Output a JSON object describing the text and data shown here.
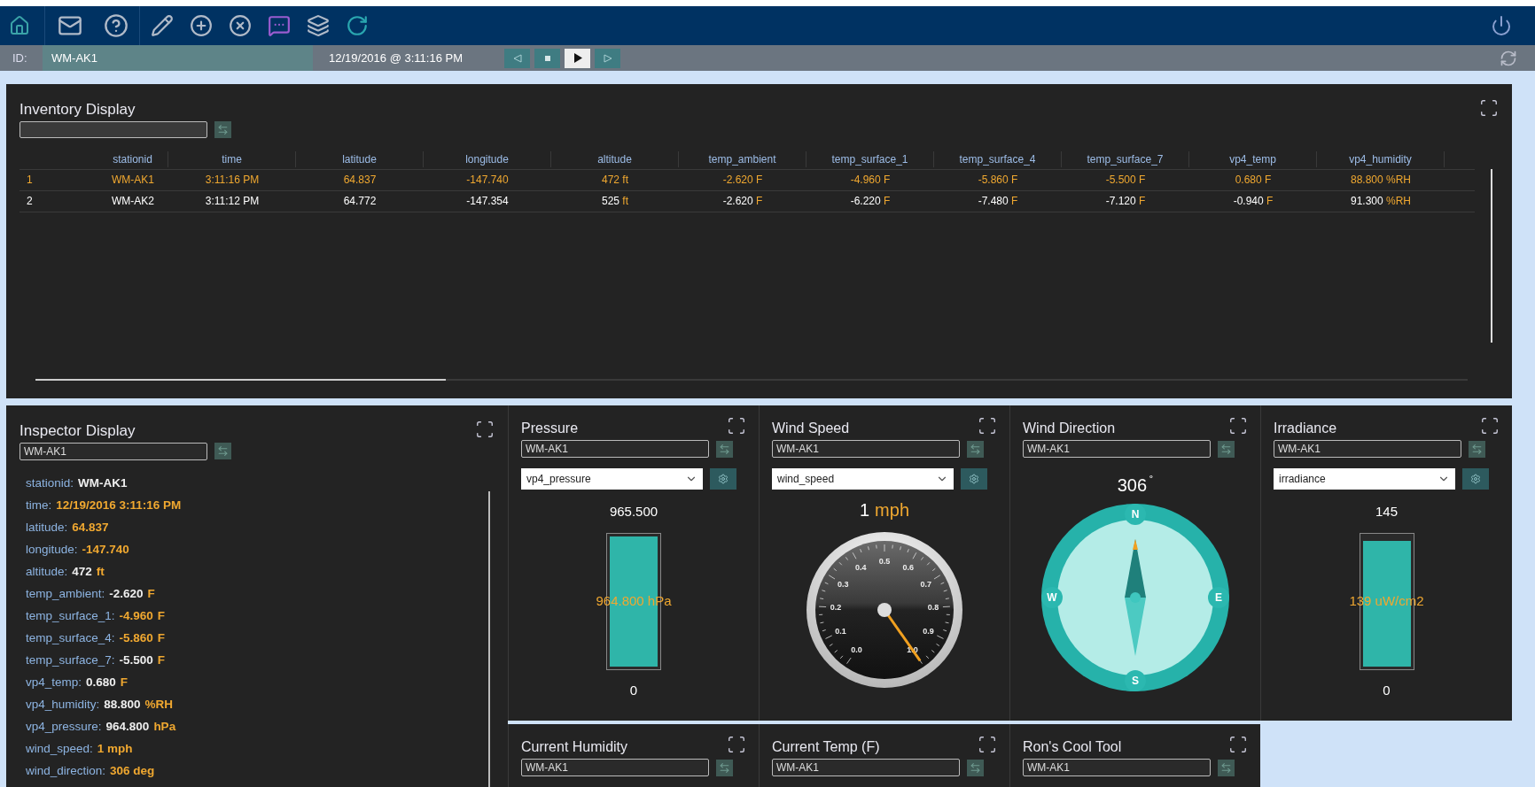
{
  "id_bar": {
    "label": "ID:",
    "value": "WM-AK1",
    "timestamp": "12/19/2016 @ 3:11:16 PM",
    "playback": [
      {
        "kind": "back",
        "selected": false
      },
      {
        "kind": "stop",
        "selected": false
      },
      {
        "kind": "play",
        "selected": true
      },
      {
        "kind": "forward",
        "selected": false
      }
    ]
  },
  "inventory": {
    "title": "Inventory Display",
    "columns": [
      "stationid",
      "time",
      "latitude",
      "longitude",
      "altitude",
      "temp_ambient",
      "temp_surface_1",
      "temp_surface_4",
      "temp_surface_7",
      "vp4_temp",
      "vp4_humidity"
    ],
    "rows": [
      {
        "number": "1",
        "highlighted": true,
        "cells": [
          {
            "value": "WM-AK1"
          },
          {
            "value": "3:11:16 PM"
          },
          {
            "value": "64.837"
          },
          {
            "value": "-147.740"
          },
          {
            "value": "472",
            "unit": "ft"
          },
          {
            "value": "-2.620",
            "unit": "F"
          },
          {
            "value": "-4.960",
            "unit": "F"
          },
          {
            "value": "-5.860",
            "unit": "F"
          },
          {
            "value": "-5.500",
            "unit": "F"
          },
          {
            "value": "0.680",
            "unit": "F"
          },
          {
            "value": "88.800",
            "unit": "%RH"
          }
        ]
      },
      {
        "number": "2",
        "highlighted": false,
        "cells": [
          {
            "value": "WM-AK2"
          },
          {
            "value": "3:11:12 PM"
          },
          {
            "value": "64.772"
          },
          {
            "value": "-147.354"
          },
          {
            "value": "525",
            "unit": "ft"
          },
          {
            "value": "-2.620",
            "unit": "F"
          },
          {
            "value": "-6.220",
            "unit": "F"
          },
          {
            "value": "-7.480",
            "unit": "F"
          },
          {
            "value": "-7.120",
            "unit": "F"
          },
          {
            "value": "-0.940",
            "unit": "F"
          },
          {
            "value": "91.300",
            "unit": "%RH"
          }
        ]
      }
    ]
  },
  "inspector": {
    "title": "Inspector Display",
    "station": "WM-AK1",
    "fields": [
      {
        "key": "stationid:",
        "value": "WM-AK1",
        "highlighted": false
      },
      {
        "key": "time:",
        "value": "12/19/2016 3:11:16 PM",
        "highlighted": true
      },
      {
        "key": "latitude:",
        "value": "64.837",
        "highlighted": true
      },
      {
        "key": "longitude:",
        "value": "-147.740",
        "highlighted": true
      },
      {
        "key": "altitude:",
        "value": "472",
        "unit": "ft",
        "highlighted": false
      },
      {
        "key": "temp_ambient:",
        "value": "-2.620",
        "unit": "F",
        "highlighted": false
      },
      {
        "key": "temp_surface_1:",
        "value": "-4.960",
        "unit": "F",
        "highlighted": true
      },
      {
        "key": "temp_surface_4:",
        "value": "-5.860",
        "unit": "F",
        "highlighted": true
      },
      {
        "key": "temp_surface_7:",
        "value": "-5.500",
        "unit": "F",
        "highlighted": false
      },
      {
        "key": "vp4_temp:",
        "value": "0.680",
        "unit": "F",
        "highlighted": false
      },
      {
        "key": "vp4_humidity:",
        "value": "88.800",
        "unit": "%RH",
        "highlighted": false
      },
      {
        "key": "vp4_pressure:",
        "value": "964.800",
        "unit": "hPa",
        "highlighted": false
      },
      {
        "key": "wind_speed:",
        "value": "1 mph",
        "highlighted": true
      },
      {
        "key": "wind_direction:",
        "value": "306 deg",
        "highlighted": true
      }
    ]
  },
  "widgets": [
    {
      "kind": "bar",
      "title": "Pressure",
      "station": "WM-AK1",
      "variable": "vp4_pressure",
      "max": "965.500",
      "reading": "964.800 hPa",
      "min": "0",
      "level": 1
    },
    {
      "kind": "dial",
      "title": "Wind Speed",
      "station": "WM-AK1",
      "variable": "wind_speed",
      "value": "1",
      "unit": "mph",
      "ticks": [
        "0.0",
        "0.1",
        "0.2",
        "0.3",
        "0.4",
        "0.5",
        "0.6",
        "0.7",
        "0.8",
        "0.9",
        "1.0"
      ]
    },
    {
      "kind": "compass",
      "title": "Wind Direction",
      "station": "WM-AK1",
      "heading": "306",
      "unit": "˚",
      "points": [
        "N",
        "E",
        "S",
        "W"
      ]
    },
    {
      "kind": "bar",
      "title": "Irradiance",
      "station": "WM-AK1",
      "variable": "irradiance",
      "max": "145",
      "reading": "139 uW/cm2",
      "min": "0",
      "level": 0.96
    },
    {
      "kind": "empty",
      "title": "Current Humidity",
      "station": "WM-AK1"
    },
    {
      "kind": "empty",
      "title": "Current Temp (F)",
      "station": "WM-AK1"
    },
    {
      "kind": "empty",
      "title": "Ron's Cool Tool",
      "station": "WM-AK1"
    }
  ]
}
